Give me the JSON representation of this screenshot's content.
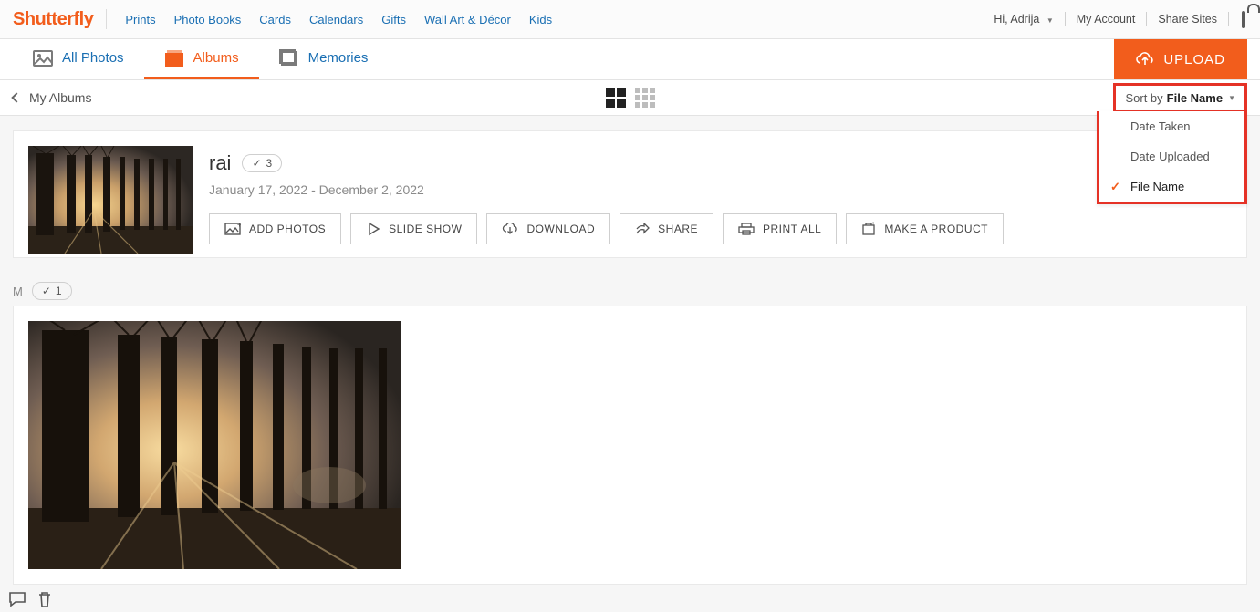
{
  "header": {
    "logo": "Shutterfly",
    "nav": [
      "Prints",
      "Photo Books",
      "Cards",
      "Calendars",
      "Gifts",
      "Wall Art & Décor",
      "Kids"
    ],
    "greeting": "Hi, Adrija",
    "my_account": "My Account",
    "share_sites": "Share Sites"
  },
  "tabs": {
    "all_photos": "All Photos",
    "albums": "Albums",
    "memories": "Memories",
    "upload": "UPLOAD"
  },
  "toolbar": {
    "back": "My Albums",
    "sort_prefix": "Sort by ",
    "sort_value": "File Name",
    "sort_options": {
      "date_taken": "Date Taken",
      "date_uploaded": "Date Uploaded",
      "file_name": "File Name"
    }
  },
  "album": {
    "title": "rai",
    "count": "3",
    "date_range": "January 17, 2022 - December 2, 2022",
    "actions": {
      "add_photos": "ADD PHOTOS",
      "slide_show": "SLIDE SHOW",
      "download": "DOWNLOAD",
      "share": "SHARE",
      "print_all": "PRINT ALL",
      "make_product": "MAKE A PRODUCT"
    }
  },
  "group": {
    "letter": "M",
    "selected_count": "1"
  }
}
